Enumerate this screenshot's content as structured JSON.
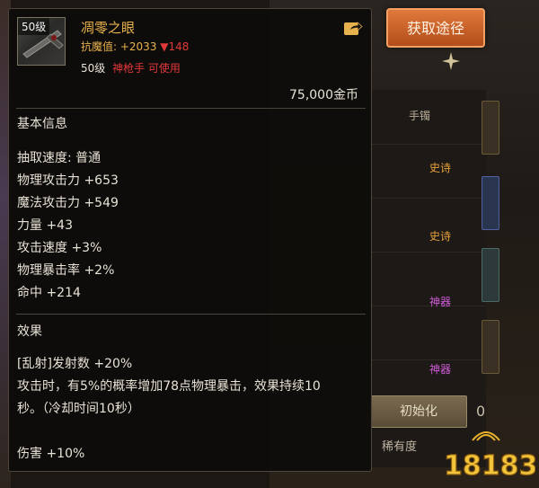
{
  "background": {
    "get_route_button": "获取途径",
    "rarity_labels": [
      "手镯",
      "史诗",
      "史诗",
      "神器",
      "神器"
    ],
    "reset_button": "初始化",
    "durability_label": "稀有度",
    "side_number": "0",
    "logo_text": "18183"
  },
  "tooltip": {
    "level_tag": "50级",
    "item_name": "凋零之眼",
    "resist_label": "抗魔值: +2033",
    "resist_change": "▼148",
    "req_level": "50级",
    "req_class": "神枪手 可使用",
    "price": "75,000金币",
    "basic_section_title": "基本信息",
    "stats": [
      "抽取速度: 普通",
      "物理攻击力 +653",
      "魔法攻击力 +549",
      "力量 +43",
      "攻击速度 +3%",
      "物理暴击率 +2%",
      "命中 +214"
    ],
    "effect_section_title": "效果",
    "effects": [
      "[乱射]发射数 +20%",
      "攻击时，有5%的概率增加78点物理暴击，效果持续10",
      "秒。（冷却时间10秒）",
      "伤害 +10%"
    ]
  },
  "colors": {
    "item_name": "#e7b24d",
    "negative": "#e2383a",
    "button_orange": "#d06a30"
  }
}
